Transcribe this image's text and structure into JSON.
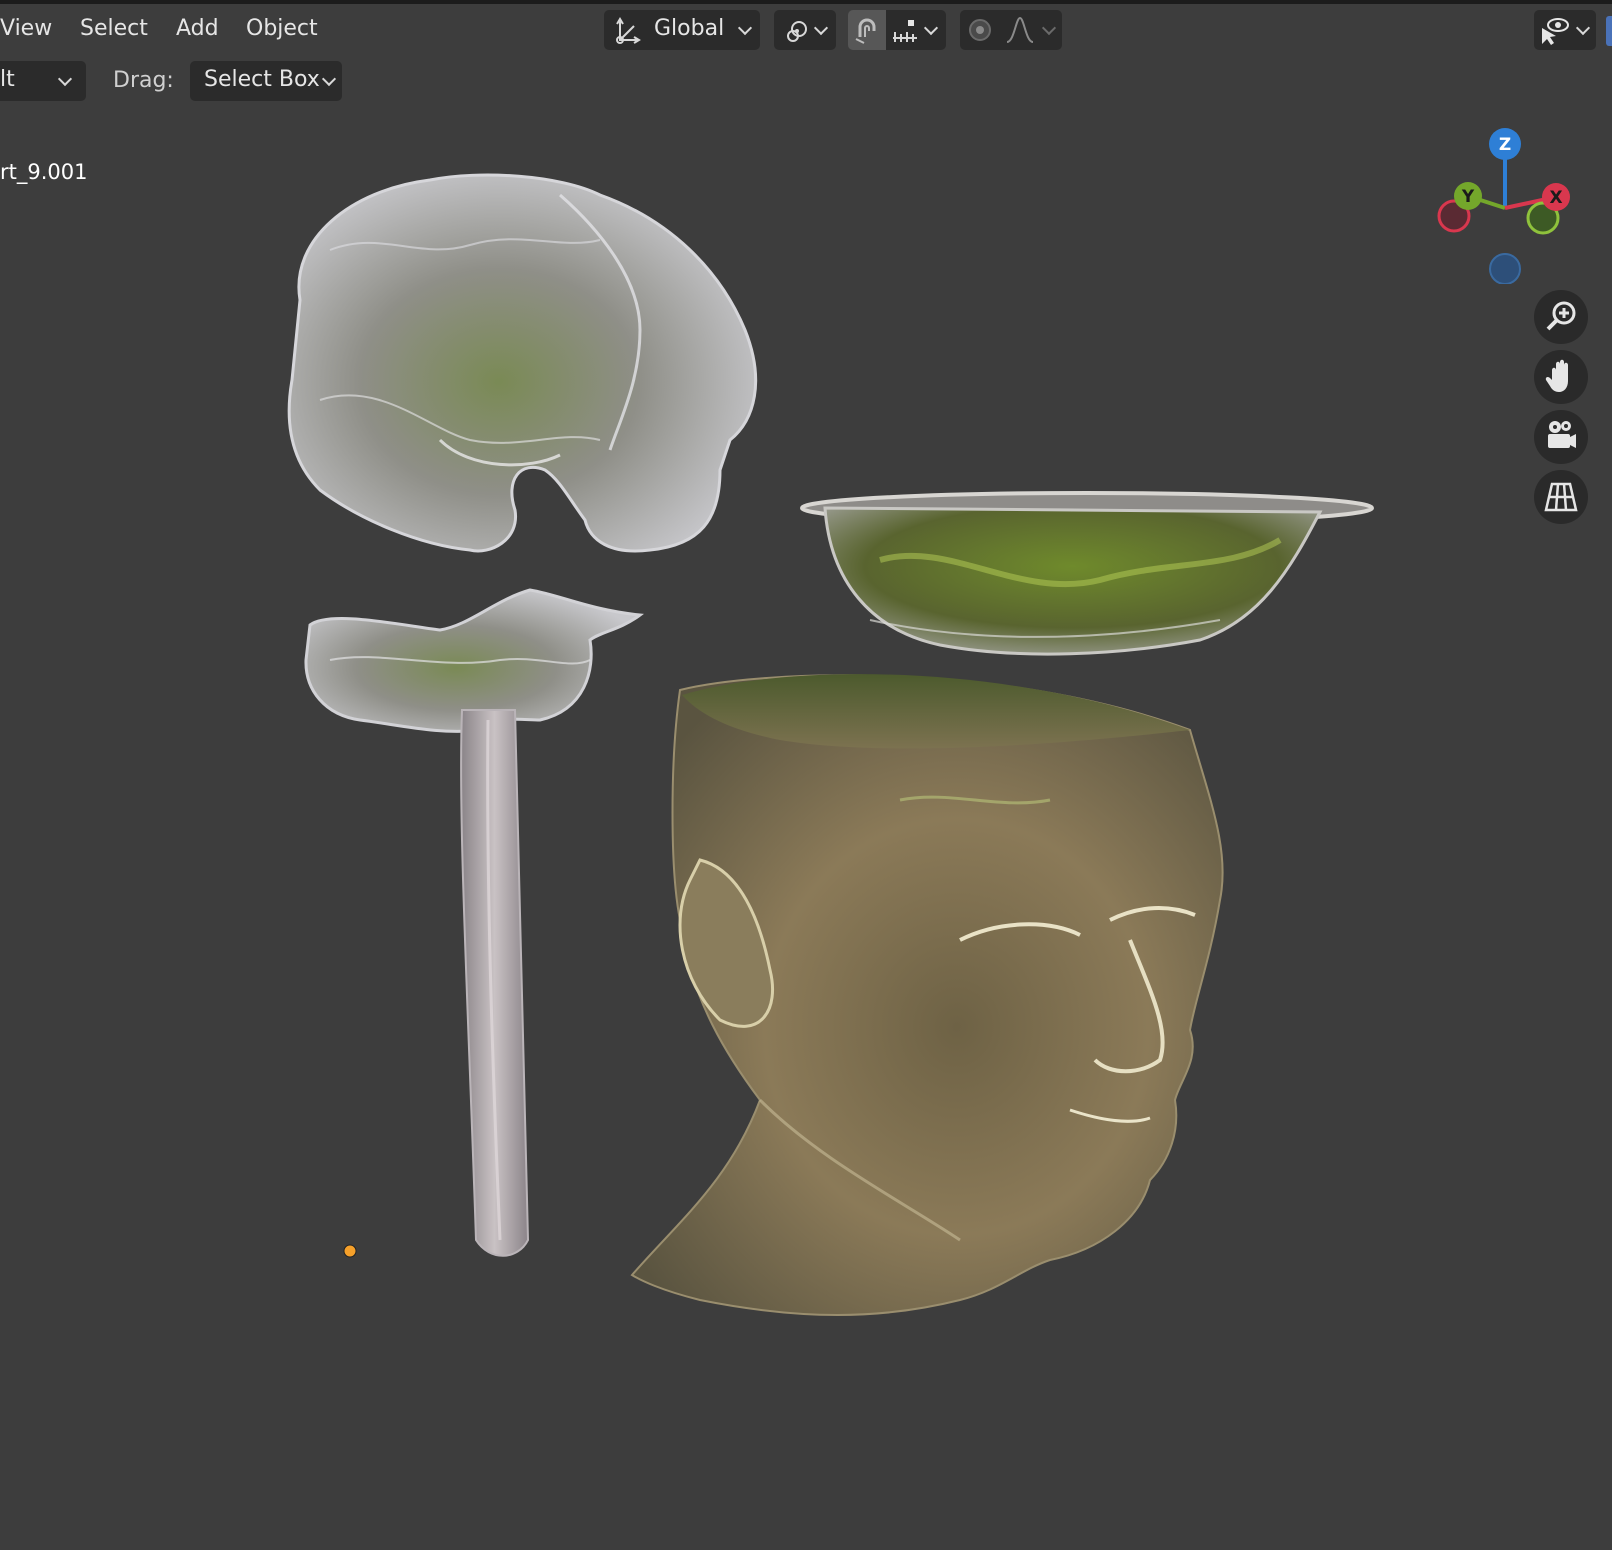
{
  "header": {
    "menus": [
      {
        "label": "View"
      },
      {
        "label": "Select"
      },
      {
        "label": "Add"
      },
      {
        "label": "Object"
      }
    ],
    "transform_orientation": "Global"
  },
  "toolbar": {
    "mode_value": "lt",
    "drag_label": "Drag:",
    "drag_value": "Select Box"
  },
  "viewport": {
    "active_object": "rt_9.001",
    "gizmo": {
      "z_label": "Z",
      "y_label": "Y",
      "x_label": "X",
      "colors": {
        "x": "#d9374e",
        "y": "#74a72b",
        "z": "#2e7fd6"
      }
    },
    "nav_icons": [
      "zoom-icon",
      "hand-icon",
      "camera-icon",
      "grid-icon"
    ]
  }
}
